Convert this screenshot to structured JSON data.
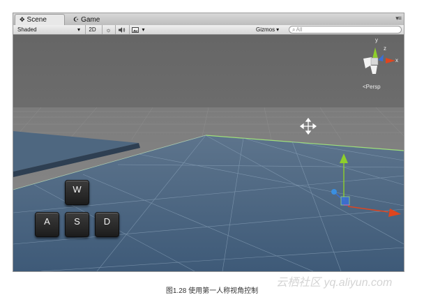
{
  "tabs": [
    {
      "label": "Scene",
      "icon": "scene-icon"
    },
    {
      "label": "Game",
      "icon": "game-icon"
    }
  ],
  "window_menu": "▾≡",
  "toolbar": {
    "draw_mode": "Shaded",
    "mode_2d": "2D",
    "lighting_icon": "sun-icon",
    "audio_icon": "speaker-icon",
    "effects_icon": "image-icon",
    "gizmos_label": "Gizmos",
    "search_placeholder": "All"
  },
  "scene_gizmo": {
    "y_label": "y",
    "z_label": "z",
    "x_label": "x",
    "projection_label": "Persp"
  },
  "keys": [
    "W",
    "A",
    "S",
    "D"
  ],
  "caption": "图1.28    使用第一人称视角控制",
  "watermark": "云栖社区 yq.aliyun.com",
  "colors": {
    "sky": "#6d6d6d",
    "ground_plane": "#4a6580",
    "axis_x": "#e0451e",
    "axis_y": "#8ecf2a",
    "axis_z": "#3a6fd6"
  }
}
